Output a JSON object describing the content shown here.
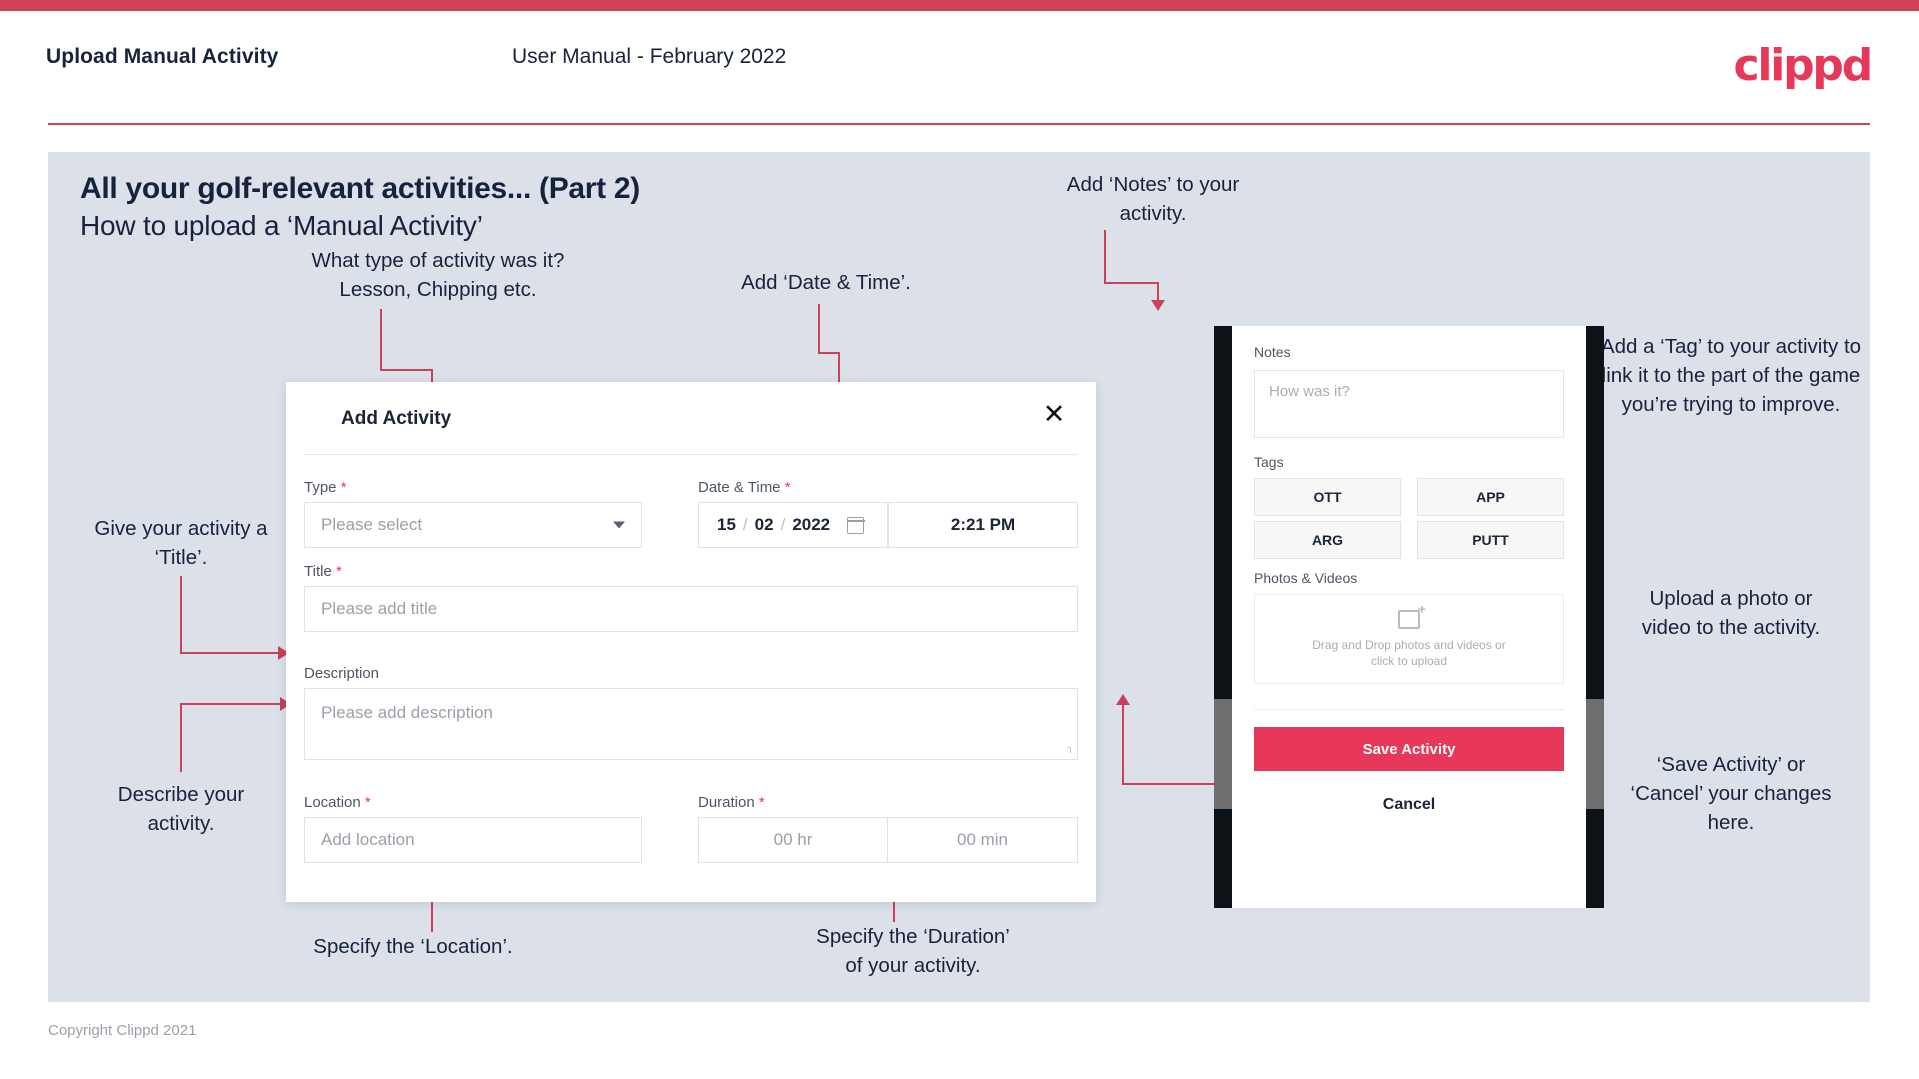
{
  "header": {
    "title": "Upload Manual Activity",
    "subtitle": "User Manual - February 2022",
    "logo": "clippd"
  },
  "slide": {
    "title": "All your golf-relevant activities... (Part 2)",
    "subtitle": "How to upload a ‘Manual Activity’"
  },
  "annotations": {
    "type": "What type of activity was it?\nLesson, Chipping etc.",
    "type_line1": "What type of activity was it?",
    "type_line2": "Lesson, Chipping etc.",
    "datetime": "Add ‘Date & Time’.",
    "title_field": "Give your activity a\n‘Title’.",
    "title_field_line1": "Give your activity a",
    "title_field_line2": "‘Title’.",
    "description": "Describe your\nactivity.",
    "description_line1": "Describe your",
    "description_line2": "activity.",
    "location": "Specify the ‘Location’.",
    "duration_line1": "Specify the ‘Duration’",
    "duration_line2": "of your activity.",
    "notes_line1": "Add ‘Notes’ to your",
    "notes_line2": "activity.",
    "tags": "Add a ‘Tag’ to your activity to link it to the part of the game you’re trying to improve.",
    "upload_line1": "Upload a photo or",
    "upload_line2": "video to the activity.",
    "save_line1": "‘Save Activity’ or",
    "save_line2": "‘Cancel’ your changes",
    "save_line3": "here."
  },
  "dialog": {
    "title": "Add Activity",
    "close_icon": "✕",
    "fields": {
      "type": {
        "label": "Type",
        "required": "*",
        "placeholder": "Please select"
      },
      "datetime": {
        "label": "Date & Time",
        "required": "*",
        "day": "15",
        "month": "02",
        "year": "2022",
        "sep": "/",
        "time": "2:21 PM"
      },
      "title": {
        "label": "Title",
        "required": "*",
        "placeholder": "Please add title"
      },
      "description": {
        "label": "Description",
        "required": "",
        "placeholder": "Please add description"
      },
      "location": {
        "label": "Location",
        "required": "*",
        "placeholder": "Add location"
      },
      "duration": {
        "label": "Duration",
        "required": "*",
        "hours": "00 hr",
        "minutes": "00 min"
      }
    }
  },
  "phone": {
    "notes_label": "Notes",
    "notes_placeholder": "How was it?",
    "tags_label": "Tags",
    "tags": [
      "OTT",
      "APP",
      "ARG",
      "PUTT"
    ],
    "photos_label": "Photos & Videos",
    "upload_text_line1": "Drag and Drop photos and videos or",
    "upload_text_line2": "click to upload",
    "save_label": "Save Activity",
    "cancel_label": "Cancel"
  },
  "footer": {
    "copyright": "Copyright Clippd 2021"
  },
  "colors": {
    "brand_pink": "#e8385a",
    "accent_line": "#c94257",
    "slide_bg": "#dce1e9",
    "text_dark": "#16233c"
  }
}
